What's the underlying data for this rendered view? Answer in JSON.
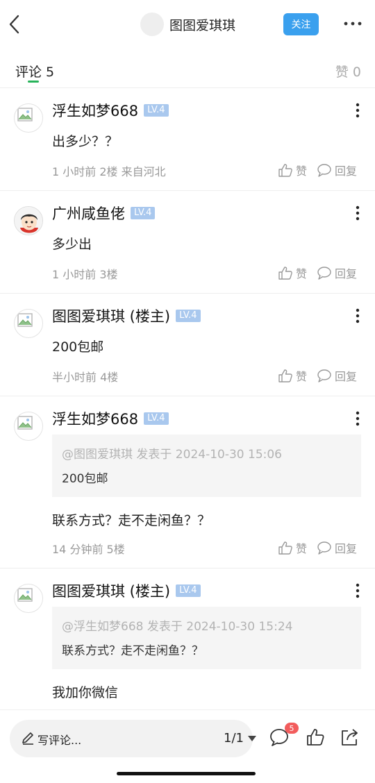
{
  "header": {
    "title": "图图爱琪琪",
    "follow_label": "关注"
  },
  "tabs": {
    "comments_label": "评论 5",
    "likes_label": "赞 0"
  },
  "comments": [
    {
      "name": "浮生如梦668",
      "level": "LV.4",
      "text": "出多少？？",
      "meta": "1 小时前  2楼  来自河北",
      "like_label": "赞",
      "reply_label": "回复",
      "avatar": "broken-image-icon"
    },
    {
      "name": "广州咸鱼佬",
      "level": "LV.4",
      "text": "多少出",
      "meta": "1 小时前  3楼",
      "like_label": "赞",
      "reply_label": "回复",
      "avatar": "cartoon-avatar"
    },
    {
      "name": "图图爱琪琪 (楼主)",
      "level": "LV.4",
      "text": "200包邮",
      "meta": "半小时前  4楼",
      "like_label": "赞",
      "reply_label": "回复",
      "avatar": "broken-image-icon"
    },
    {
      "name": "浮生如梦668",
      "level": "LV.4",
      "quote_head": "@图图爱琪琪 发表于 2024-10-30 15:06",
      "quote_body": "200包邮",
      "text": "联系方式？走不走闲鱼？？",
      "meta": "14 分钟前  5楼",
      "like_label": "赞",
      "reply_label": "回复",
      "avatar": "broken-image-icon"
    },
    {
      "name": "图图爱琪琪 (楼主)",
      "level": "LV.4",
      "quote_head": "@浮生如梦668 发表于 2024-10-30 15:24",
      "quote_body": "联系方式？走不走闲鱼？？",
      "text": "我加你微信",
      "avatar": "broken-image-icon"
    }
  ],
  "bottom": {
    "composer_placeholder": "写评论...",
    "page_indicator": "1/1",
    "comment_count_badge": "5"
  },
  "colors": {
    "accent_blue": "#3aa0ee",
    "tab_indicator_green": "#27b35a",
    "level_badge": "#a9c8ee",
    "badge_red": "#f25c5c"
  }
}
